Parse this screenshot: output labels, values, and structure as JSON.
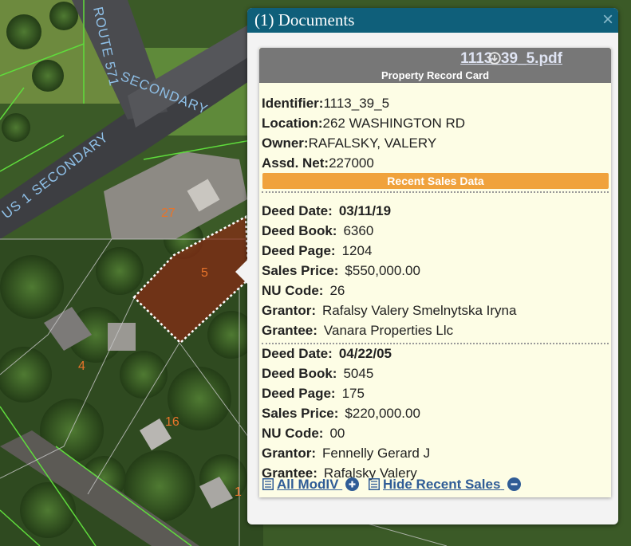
{
  "map": {
    "road_labels": [
      "ROUTE 571 SECONDARY",
      "US 1 SECONDARY"
    ],
    "lot_numbers": [
      "27",
      "5",
      "4",
      "16",
      "1"
    ]
  },
  "popup": {
    "title": "(1) Documents",
    "close_symbol": "×",
    "card": {
      "pdf_name": "1113_39_5.pdf",
      "download_icon": "download-icon",
      "subtitle": "Property Record Card",
      "fields": [
        {
          "label": "Identifier:",
          "value": "1113_39_5"
        },
        {
          "label": "Location:",
          "value": "262 WASHINGTON RD"
        },
        {
          "label": "Owner:",
          "value": "RAFALSKY, VALERY"
        },
        {
          "label": "Assd. Net:",
          "value": "227000"
        }
      ],
      "sales_banner": "Recent Sales Data",
      "sales": [
        {
          "rows": [
            {
              "label": "Deed Date:",
              "value": "03/11/19"
            },
            {
              "label": "Deed Book:",
              "value": "6360"
            },
            {
              "label": "Deed Page:",
              "value": "1204"
            },
            {
              "label": "Sales Price:",
              "value": "$550,000.00"
            },
            {
              "label": "NU Code:",
              "value": "26"
            },
            {
              "label": "Grantor:",
              "value": "Rafalsy Valery Smelnytska Iryna"
            },
            {
              "label": "Grantee:",
              "value": "Vanara Properties Llc"
            }
          ]
        },
        {
          "rows": [
            {
              "label": "Deed Date:",
              "value": "04/22/05"
            },
            {
              "label": "Deed Book:",
              "value": "5045"
            },
            {
              "label": "Deed Page:",
              "value": "175"
            },
            {
              "label": "Sales Price:",
              "value": "$220,000.00"
            },
            {
              "label": "NU Code:",
              "value": "00"
            },
            {
              "label": "Grantor:",
              "value": "Fennelly Gerard J"
            },
            {
              "label": "Grantee:",
              "value": "Rafalsky Valery"
            }
          ]
        }
      ],
      "footer": {
        "all_modiv_label": "All ModIV",
        "hide_sales_label": "Hide Recent Sales"
      }
    }
  },
  "colors": {
    "header_bg": "#0f5f7a",
    "card_bg": "#fdfde5",
    "banner": "#f0a23c",
    "link": "#2f5c96",
    "lot_label": "#e8742a",
    "parcel_line": "#5fdc3c",
    "selected_parcel_fill": "#8a2a14"
  }
}
